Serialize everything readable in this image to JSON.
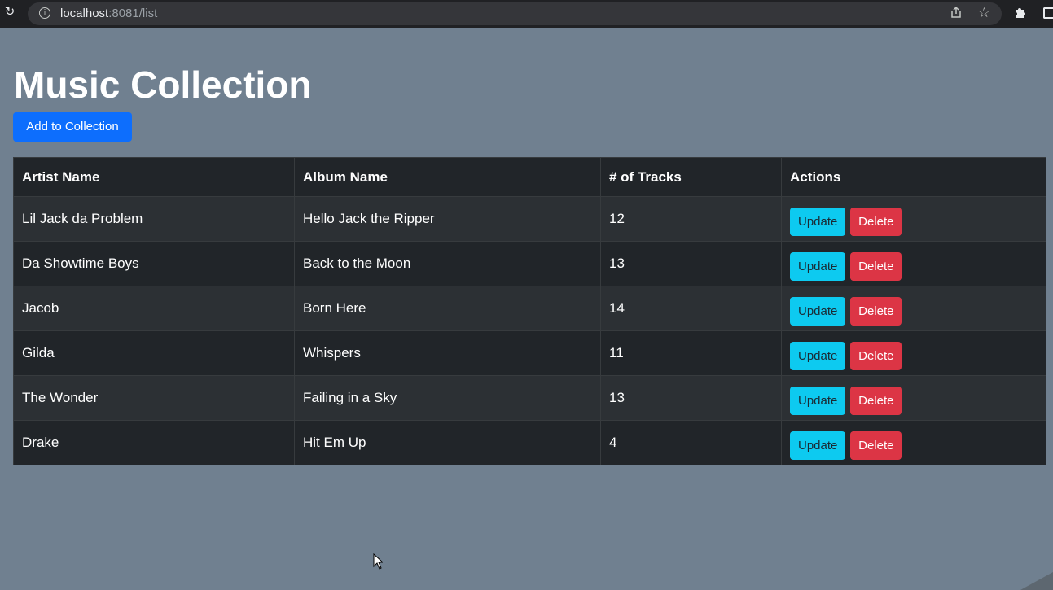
{
  "browser": {
    "url_host": "localhost",
    "url_rest": ":8081/list",
    "icons": [
      "reload-icon",
      "info-icon",
      "share-icon",
      "star-icon",
      "extensions-icon",
      "side-panel-icon"
    ]
  },
  "page": {
    "title": "Music Collection",
    "add_button": "Add to Collection"
  },
  "table": {
    "headers": [
      "Artist Name",
      "Album Name",
      "# of Tracks",
      "Actions"
    ],
    "rows": [
      {
        "artist": "Lil Jack da Problem",
        "album": "Hello Jack the Ripper",
        "tracks": "12"
      },
      {
        "artist": "Da Showtime Boys",
        "album": "Back to the Moon",
        "tracks": "13"
      },
      {
        "artist": "Jacob",
        "album": "Born Here",
        "tracks": "14"
      },
      {
        "artist": "Gilda",
        "album": "Whispers",
        "tracks": "11"
      },
      {
        "artist": "The Wonder",
        "album": "Failing in a Sky",
        "tracks": "13"
      },
      {
        "artist": "Drake",
        "album": "Hit Em Up",
        "tracks": "4"
      }
    ],
    "update_label": "Update",
    "delete_label": "Delete"
  },
  "colors": {
    "page_background": "#708090",
    "primary": "#0d6efd",
    "info": "#0dcaf0",
    "danger": "#dc3545",
    "table_dark": "#212529",
    "table_stripe": "#2c3034"
  }
}
